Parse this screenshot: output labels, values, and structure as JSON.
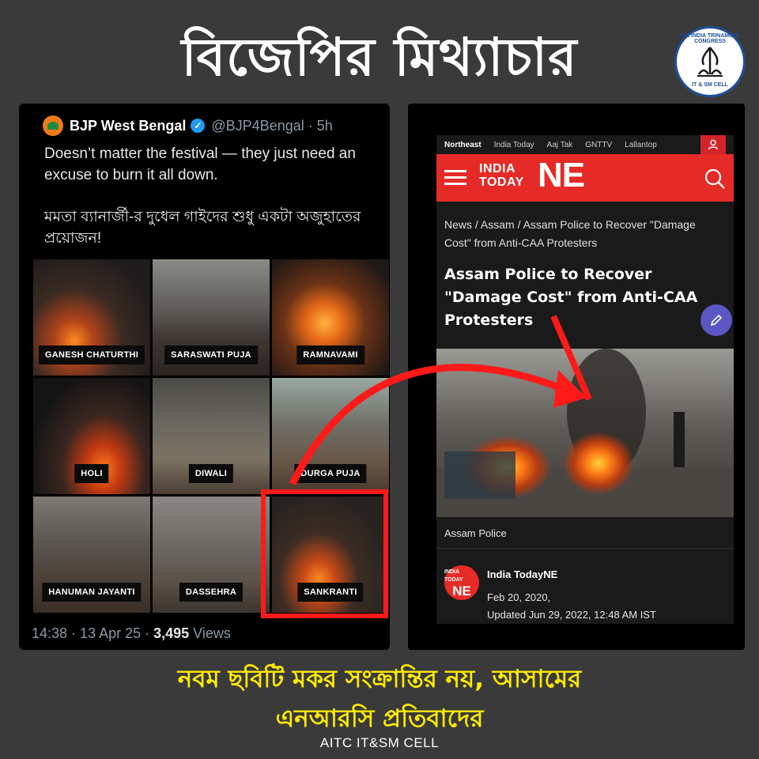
{
  "headline": "বিজেপির মিথ্যাচার",
  "party_logo": {
    "top_text": "ALL INDIA TRINAMOOL CONGRESS",
    "bottom_text": "IT & SM CELL"
  },
  "tweet": {
    "author": "BJP West Bengal",
    "handle": "@BJP4Bengal · 5h",
    "text_en": "Doesn’t matter the festival — they just need an excuse to burn it all down.",
    "text_bn": "মমতা ব্যানার্জী-র দুধেল গাইদের শুধু একটা অজুহাতের প্রয়োজন!",
    "tiles": [
      "GANESH CHATURTHI",
      "SARASWATI PUJA",
      "RAMNAVAMI",
      "HOLI",
      "DIWALI",
      "DURGA PUJA",
      "HANUMAN JAYANTI",
      "DASSEHRA",
      "SANKRANTI"
    ],
    "timestamp": "14:38 · 13 Apr 25 · ",
    "views_count": "3,495",
    "views_label": " Views"
  },
  "article": {
    "nav": [
      "Northeast",
      "India Today",
      "Aaj Tak",
      "GNTTV",
      "Lallantop"
    ],
    "brand_small": "INDIA\nTODAY",
    "brand_big": "NE",
    "breadcrumb": "News / Assam / Assam Police to Recover \"Damage Cost\" from Anti-CAA Protesters",
    "title": "Assam Police to Recover \"Damage Cost\" from Anti-CAA Protesters",
    "caption": "Assam Police",
    "author": "India TodayNE",
    "author_logo_small": "INDIA TODAY",
    "author_logo_big": "NE",
    "date": "Feb 20, 2020,",
    "updated": "Updated Jun 29, 2022, 12:48 AM IST"
  },
  "bottom_line1": "নবম ছবিটি মকর সংক্রান্তির নয়, আসামের",
  "bottom_line2": "এনআরসি প্রতিবাদের",
  "credit": "AITC IT&SM CELL",
  "colors": {
    "background": "#3a3a3a",
    "highlight": "#ff1a1a",
    "brand_red": "#e52a27",
    "caption_yellow": "#ffeb00"
  }
}
